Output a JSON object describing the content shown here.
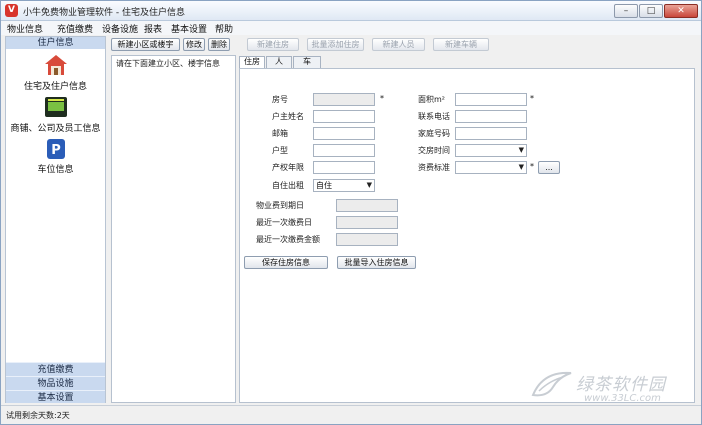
{
  "window": {
    "title": "小牛免费物业管理软件 - 住宅及住户信息",
    "app_icon_glyph": "V",
    "accent_color": "#d8342b"
  },
  "menu": [
    "物业信息",
    "充值缴费",
    "设备设施",
    "报表",
    "基本设置",
    "帮助"
  ],
  "sidebar": {
    "header": "住户信息",
    "items": [
      {
        "label": "住宅及住户信息",
        "icon": "house-icon"
      },
      {
        "label": "商铺、公司及员工信息",
        "icon": "shop-icon"
      },
      {
        "label": "车位信息",
        "icon": "parking-icon"
      }
    ],
    "bottom_sections": [
      "充值缴费",
      "物品设施",
      "基本设置"
    ]
  },
  "toolbar": {
    "new_community": "新建小区或楼宇",
    "edit": "修改",
    "delete": "删除",
    "new_house": "新建住房",
    "batch_add_house": "批量添加住房",
    "new_person": "新建人员",
    "new_vehicle": "新建车辆"
  },
  "tree": {
    "hint": "请在下面建立小区、楼宇信息"
  },
  "tabs": [
    "住房",
    "人",
    "车"
  ],
  "form": {
    "room_no": {
      "label": "房号",
      "value": ""
    },
    "area": {
      "label": "面积m²",
      "value": ""
    },
    "owner_name": {
      "label": "户主姓名",
      "value": ""
    },
    "contact_phone": {
      "label": "联系电话",
      "value": ""
    },
    "postcode": {
      "label": "邮箱",
      "value": ""
    },
    "home_phone": {
      "label": "家庭号码",
      "value": ""
    },
    "house_type": {
      "label": "户型",
      "value": ""
    },
    "delivery_time": {
      "label": "交房时间",
      "value": ""
    },
    "property_years": {
      "label": "产权年限",
      "value": ""
    },
    "fee_standard": {
      "label": "资费标准",
      "value": ""
    },
    "occupancy": {
      "label": "自住出租",
      "value": "自住"
    },
    "property_fee_due": {
      "label": "物业费到期日",
      "value": ""
    },
    "last_payment_date": {
      "label": "最近一次缴费日",
      "value": ""
    },
    "last_payment_amount": {
      "label": "最近一次缴费金额",
      "value": ""
    },
    "required_mark": "*",
    "ellipsis_button": "...",
    "save_button": "保存住房信息",
    "batch_import_button": "批量导入住房信息"
  },
  "status": {
    "trial_text": "试用剩余天数:2天"
  },
  "watermark": {
    "name": "绿茶软件园",
    "url": "www.33LC.com"
  }
}
